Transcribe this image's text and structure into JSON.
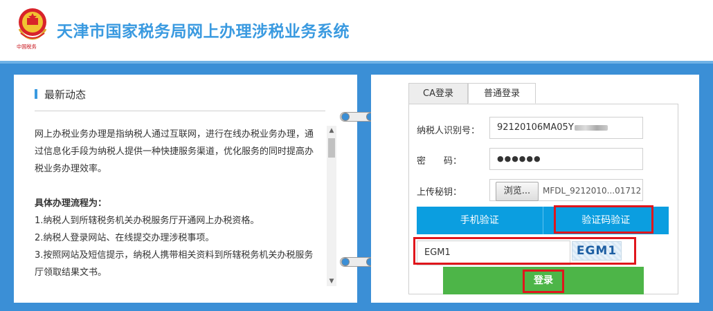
{
  "header": {
    "emblem_caption": "中国税务",
    "title": "天津市国家税务局网上办理涉税业务系统"
  },
  "news": {
    "title": "最新动态",
    "intro": "网上办税业务办理是指纳税人通过互联网，进行在线办税业务办理，通过信息化手段为纳税人提供一种快捷服务渠道，优化服务的同时提高办税业务办理效率。",
    "process_heading": "具体办理流程为：",
    "steps": [
      "1.纳税人到所辖税务机关办税服务厅开通网上办税资格。",
      "2.纳税人登录网站、在线提交办理涉税事项。",
      "3.按照网站及短信提示，纳税人携带相关资料到所辖税务机关办税服务厅领取结果文书。"
    ],
    "scroll_up_icon": "▲",
    "scroll_down_icon": "▼"
  },
  "login": {
    "tabs": {
      "ca": "CA登录",
      "normal": "普通登录"
    },
    "taxpayer_id_label": "纳税人识别号：",
    "taxpayer_id_value": "92120106MA05Y",
    "password_label": "密　　码：",
    "password_value": "●●●●●●",
    "key_label": "上传秘钥：",
    "browse_label": "浏览...",
    "key_file_name": "MFDL_9212010...01712",
    "sms_verify_label": "手机验证",
    "captcha_verify_label": "验证码验证",
    "captcha_value": "EGM1",
    "captcha_image_text": "EGM1",
    "login_label": "登录"
  },
  "colors": {
    "brand_blue": "#3a9ae0",
    "band_blue": "#3b8fd6",
    "verify_blue": "#0b9ee0",
    "login_green": "#4db548",
    "highlight_red": "#e0161c"
  }
}
